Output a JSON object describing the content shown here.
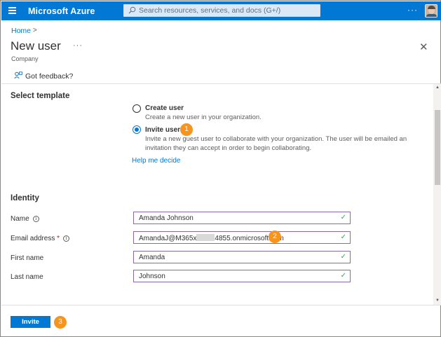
{
  "topbar": {
    "brand": "Microsoft Azure",
    "search_placeholder": "Search resources, services, and docs (G+/)",
    "more": "···",
    "accent": "#0078d4"
  },
  "header": {
    "breadcrumb": "Home",
    "breadcrumb_sep": ">",
    "title": "New user",
    "title_more": "···",
    "subtitle": "Company",
    "close": "✕",
    "feedback": "Got feedback?"
  },
  "template": {
    "section_title": "Select template",
    "options": [
      {
        "label": "Create user",
        "desc": "Create a new user in your organization.",
        "selected": false
      },
      {
        "label": "Invite user",
        "desc_line1": "Invite a new guest user to collaborate with your organization. The user will be emailed an",
        "desc_line2": "invitation they can accept in order to begin collaborating.",
        "selected": true
      }
    ],
    "help_link": "Help me decide"
  },
  "identity": {
    "section_title": "Identity",
    "fields": {
      "name": {
        "label": "Name",
        "value": "Amanda Johnson"
      },
      "email": {
        "label": "Email address",
        "required_mark": "*",
        "value_prefix": "AmandaJ@M365x",
        "value_suffix": "4855.onmicrosoft.com"
      },
      "first_name": {
        "label": "First name",
        "value": "Amanda"
      },
      "last_name": {
        "label": "Last name",
        "value": "Johnson"
      }
    },
    "info_glyph": "i",
    "check_glyph": "✓"
  },
  "footer": {
    "invite_label": "Invite"
  },
  "callouts": {
    "one": "1",
    "two": "2",
    "three": "3",
    "color": "#f7941d"
  }
}
